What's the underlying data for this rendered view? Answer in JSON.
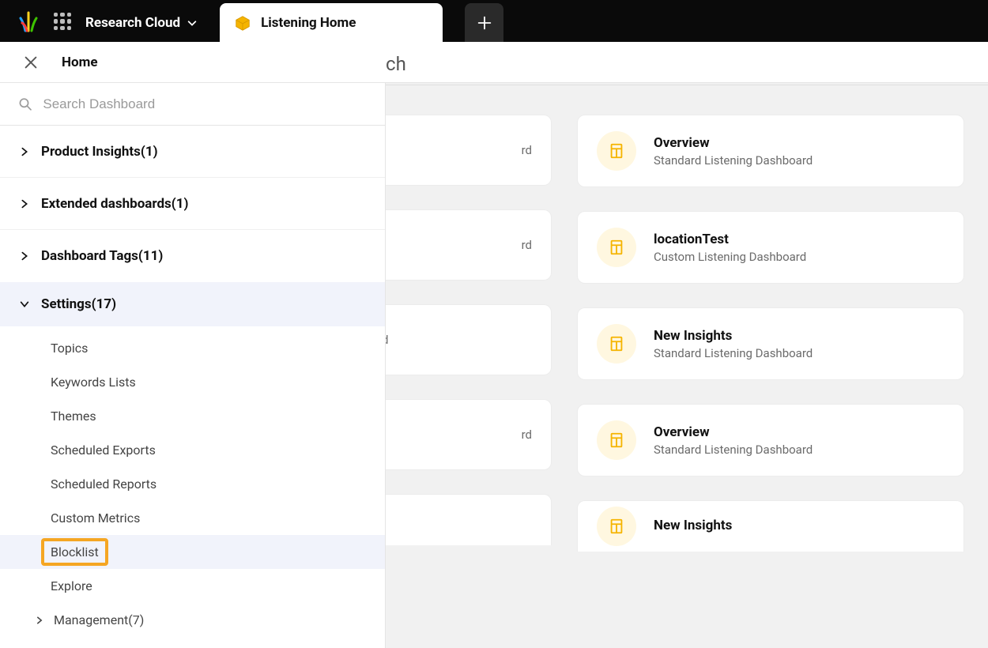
{
  "header": {
    "workspace": "Research Cloud",
    "tab_label": "Listening Home"
  },
  "subheader": {
    "title": "Home"
  },
  "search": {
    "placeholder": "Search Dashboard"
  },
  "tree": {
    "items": [
      {
        "label": "Product Insights(1)",
        "expanded": false
      },
      {
        "label": "Extended dashboards(1)",
        "expanded": false
      },
      {
        "label": "Dashboard Tags(11)",
        "expanded": false
      },
      {
        "label": "Settings(17)",
        "expanded": true
      }
    ],
    "settings_children": [
      "Topics",
      "Keywords Lists",
      "Themes",
      "Scheduled Exports",
      "Scheduled Reports",
      "Custom Metrics",
      "Blocklist",
      "Explore"
    ],
    "settings_subparent": "Management(7)"
  },
  "main": {
    "heading_suffix": "ch",
    "partial_suffix": "rd",
    "cards": [
      {
        "title": "Overview",
        "subtitle": "Standard Listening Dashboard"
      },
      {
        "title": "locationTest",
        "subtitle": "Custom Listening Dashboard"
      },
      {
        "title": "New Insights",
        "subtitle": "Standard Listening Dashboard"
      },
      {
        "title": "Overview",
        "subtitle": "Standard Listening Dashboard"
      },
      {
        "title": "New Insights",
        "subtitle": ""
      }
    ]
  }
}
